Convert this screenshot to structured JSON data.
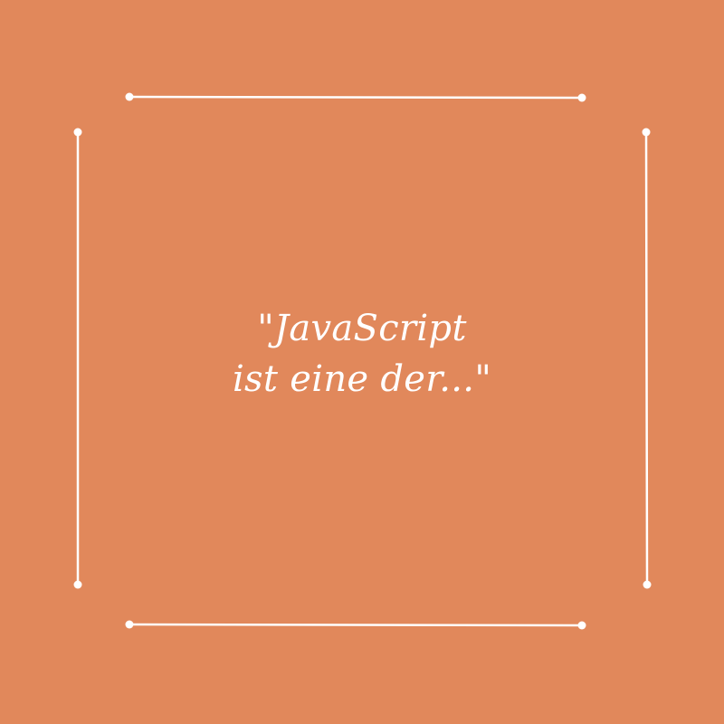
{
  "colors": {
    "background": "#e1885b",
    "foreground": "#ffffff"
  },
  "quote": {
    "line1": "\"JavaScript",
    "line2": "ist eine der...\""
  }
}
